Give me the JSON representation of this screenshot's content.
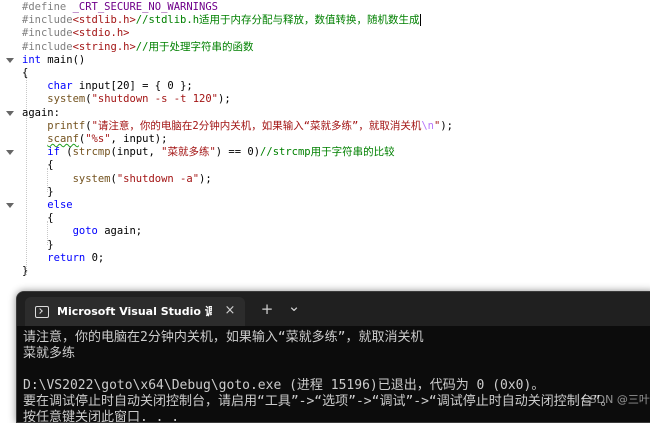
{
  "editor": {
    "lines": [
      [
        {
          "c": "pre",
          "t": "#define "
        },
        {
          "c": "mac",
          "t": "_CRT_SECURE_NO_WARNINGS"
        }
      ],
      [
        {
          "c": "pre",
          "t": "#include"
        },
        {
          "c": "inc",
          "t": "<stdlib.h>"
        },
        {
          "c": "cm",
          "t": "//stdlib.h适用于内存分配与释放，数值转换，随机数生成"
        },
        {
          "c": "caret",
          "t": ""
        }
      ],
      [
        {
          "c": "pre",
          "t": "#include"
        },
        {
          "c": "inc",
          "t": "<stdio.h>"
        }
      ],
      [
        {
          "c": "pre",
          "t": "#include"
        },
        {
          "c": "inc",
          "t": "<string.h>"
        },
        {
          "c": "cm",
          "t": "//用于处理字符串的函数"
        }
      ],
      [
        {
          "c": "kw",
          "t": "int"
        },
        {
          "c": "p",
          "t": " main()"
        }
      ],
      [
        {
          "c": "p",
          "t": "{"
        }
      ],
      [
        {
          "c": "p",
          "t": "    "
        },
        {
          "c": "kw",
          "t": "char"
        },
        {
          "c": "p",
          "t": " input[20] = { "
        },
        {
          "c": "num",
          "t": "0"
        },
        {
          "c": "p",
          "t": " };"
        }
      ],
      [
        {
          "c": "p",
          "t": "    "
        },
        {
          "c": "fn",
          "t": "system"
        },
        {
          "c": "p",
          "t": "("
        },
        {
          "c": "str",
          "t": "\"shutdown -s -t 120\""
        },
        {
          "c": "p",
          "t": ");"
        }
      ],
      [
        {
          "c": "p",
          "t": "again:"
        }
      ],
      [
        {
          "c": "p",
          "t": "    "
        },
        {
          "c": "fn",
          "t": "printf"
        },
        {
          "c": "p",
          "t": "("
        },
        {
          "c": "str",
          "t": "\"请注意，你的电脑在2分钟内关机，如果输入“菜就多练”，就取消关机"
        },
        {
          "c": "esc",
          "t": "\\n"
        },
        {
          "c": "str",
          "t": "\""
        },
        {
          "c": "p",
          "t": ");"
        }
      ],
      [
        {
          "c": "p",
          "t": "    "
        },
        {
          "c": "fn squig",
          "t": "scanf"
        },
        {
          "c": "p",
          "t": "("
        },
        {
          "c": "str",
          "t": "\"%s\""
        },
        {
          "c": "p",
          "t": ", input);"
        }
      ],
      [
        {
          "c": "p",
          "t": "    "
        },
        {
          "c": "kw",
          "t": "if"
        },
        {
          "c": "p",
          "t": " ("
        },
        {
          "c": "fn",
          "t": "strcmp"
        },
        {
          "c": "p",
          "t": "(input, "
        },
        {
          "c": "str",
          "t": "\"菜就多练\""
        },
        {
          "c": "p",
          "t": ") == "
        },
        {
          "c": "num",
          "t": "0"
        },
        {
          "c": "p",
          "t": ")"
        },
        {
          "c": "cm",
          "t": "//strcmp用于字符串的比较"
        }
      ],
      [
        {
          "c": "p",
          "t": "    {"
        }
      ],
      [
        {
          "c": "p",
          "t": "        "
        },
        {
          "c": "fn",
          "t": "system"
        },
        {
          "c": "p",
          "t": "("
        },
        {
          "c": "str",
          "t": "\"shutdown -a\""
        },
        {
          "c": "p",
          "t": ");"
        }
      ],
      [
        {
          "c": "p",
          "t": "    }"
        }
      ],
      [
        {
          "c": "p",
          "t": "    "
        },
        {
          "c": "kw",
          "t": "else"
        }
      ],
      [
        {
          "c": "p",
          "t": "    {"
        }
      ],
      [
        {
          "c": "p",
          "t": "        "
        },
        {
          "c": "kw",
          "t": "goto"
        },
        {
          "c": "p",
          "t": " again;"
        }
      ],
      [
        {
          "c": "p",
          "t": "    }"
        }
      ],
      [
        {
          "c": "p",
          "t": "    "
        },
        {
          "c": "kw",
          "t": "return"
        },
        {
          "c": "p",
          "t": " "
        },
        {
          "c": "num",
          "t": "0"
        },
        {
          "c": "p",
          "t": ";"
        }
      ],
      [
        {
          "c": "p",
          "t": "}"
        }
      ]
    ]
  },
  "terminal": {
    "tab_title": "Microsoft Visual Studio 调试控制台",
    "tab_icon": "terminal-icon",
    "close_glyph": "×",
    "new_tab_glyph": "+",
    "dropdown_glyph": "⌄",
    "output": [
      "请注意，你的电脑在2分钟内关机，如果输入“菜就多练”，就取消关机",
      "菜就多练",
      "",
      "D:\\VS2022\\goto\\x64\\Debug\\goto.exe (进程 15196)已退出，代码为 0 (0x0)。",
      "要在调试停止时自动关闭控制台，请启用“工具”->“选项”->“调试”->“调试停止时自动关闭控制台”。",
      "按任意键关闭此窗口. . ."
    ]
  },
  "watermark": "CSDN @三叶草",
  "colors": {
    "keyword": "#0000ff",
    "string": "#a31515",
    "comment": "#008000",
    "preprocessor": "#808080",
    "terminal_bg": "#0c0c0c",
    "terminal_text": "#cccccc"
  }
}
